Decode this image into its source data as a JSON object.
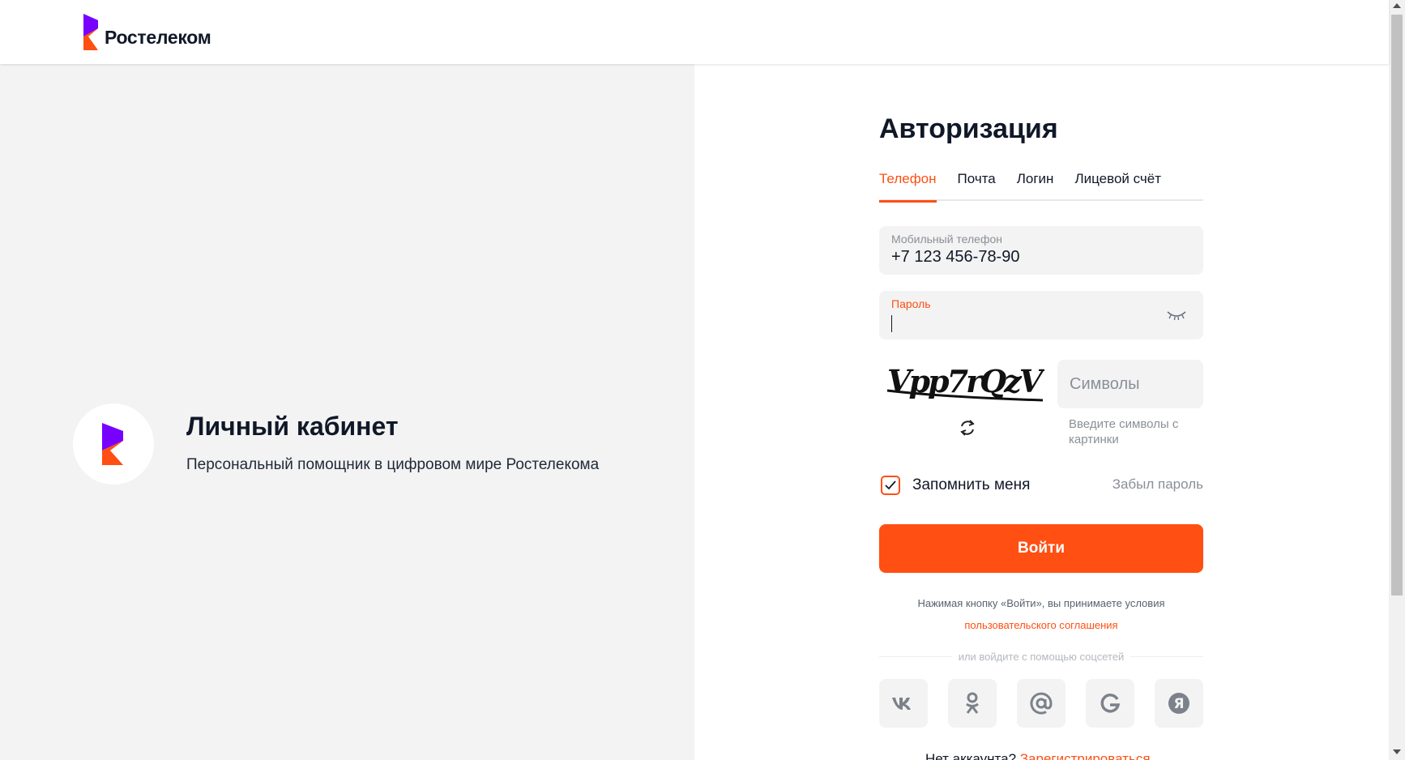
{
  "header": {
    "brand_name": "Ростелеком"
  },
  "promo": {
    "title": "Личный кабинет",
    "subtitle": "Персональный помощник в цифровом мире Ростелекома"
  },
  "auth": {
    "title": "Авторизация",
    "tabs": [
      {
        "label": "Телефон",
        "active": true
      },
      {
        "label": "Почта",
        "active": false
      },
      {
        "label": "Логин",
        "active": false
      },
      {
        "label": "Лицевой счёт",
        "active": false
      }
    ],
    "phone_field": {
      "label": "Мобильный телефон",
      "value": "+7 123 456-78-90"
    },
    "password_field": {
      "label": "Пароль",
      "value": ""
    },
    "captcha": {
      "image_text": "Vpp7rQzV",
      "input_placeholder": "Символы",
      "hint": "Введите символы с картинки"
    },
    "remember_label": "Запомнить меня",
    "remember_checked": true,
    "forgot_label": "Забыл пароль",
    "login_button": "Войти",
    "terms_text": "Нажимая кнопку «Войти», вы принимаете условия",
    "terms_link": "пользовательского соглашения",
    "social_divider": "или войдите с помощью соцсетей",
    "socials": [
      "vk-icon",
      "odnoklassniki-icon",
      "mail-icon",
      "google-icon",
      "yandex-icon"
    ],
    "register_text": "Нет аккаунта?",
    "register_link": "Зарегистрироваться"
  },
  "colors": {
    "accent": "#ff4f12",
    "brand_purple": "#7700ff",
    "panel_bg": "#f3f3f3"
  }
}
